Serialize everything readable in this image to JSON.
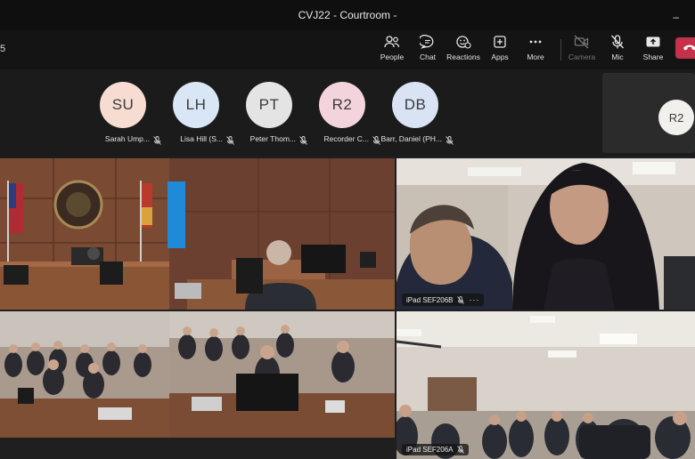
{
  "window": {
    "title": "CVJ22 - Courtroom -",
    "timer": "5",
    "window_control": "–"
  },
  "toolbar": {
    "people": "People",
    "chat": "Chat",
    "reactions": "Reactions",
    "apps": "Apps",
    "more": "More",
    "camera": "Camera",
    "mic": "Mic",
    "share": "Share"
  },
  "participants": [
    {
      "initials": "SU",
      "name": "Sarah Ump...",
      "color": "#f7dcd2"
    },
    {
      "initials": "LH",
      "name": "Lisa Hill (S...",
      "color": "#d9e6f5"
    },
    {
      "initials": "PT",
      "name": "Peter Thom...",
      "color": "#e4e4e4"
    },
    {
      "initials": "R2",
      "name": "Recorder C...",
      "color": "#f3d4dc"
    },
    {
      "initials": "DB",
      "name": "Barr, Daniel (PH...",
      "color": "#d9e3f3"
    }
  ],
  "self_view": {
    "initials": "R2"
  },
  "videos": [
    {
      "label": ""
    },
    {
      "label": "iPad SEF206B"
    },
    {
      "label": ""
    },
    {
      "label": "iPad SEF206A"
    }
  ],
  "icons": {
    "people": "people-icon",
    "chat": "chat-icon",
    "reactions": "reactions-icon",
    "apps": "apps-icon",
    "more": "more-icon",
    "camera": "camera-off-icon",
    "mic": "mic-off-icon",
    "share": "share-icon",
    "leave": "phone-leave-icon"
  },
  "colors": {
    "leave": "#c4314b",
    "toolbar": "#141414",
    "titlebar": "#0f0f0f"
  }
}
